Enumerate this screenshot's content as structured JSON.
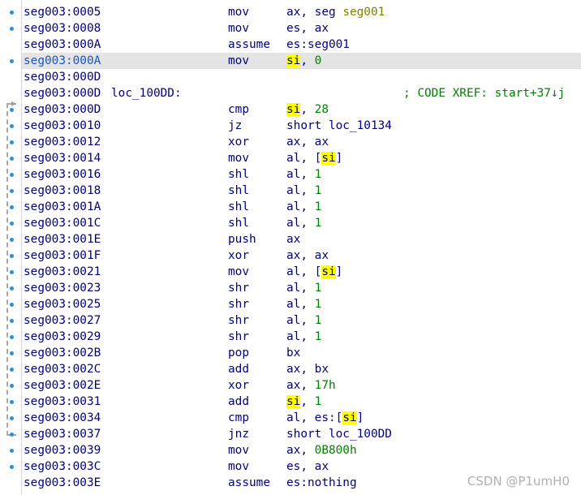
{
  "listing": {
    "rows": [
      {
        "addr": "seg003:0005",
        "label": "",
        "mnem": "mov",
        "ops": [
          {
            "t": "ax, seg ",
            "k": "reg"
          },
          {
            "t": "seg001",
            "k": "seg"
          }
        ],
        "comment": "",
        "highlight": false
      },
      {
        "addr": "seg003:0008",
        "label": "",
        "mnem": "mov",
        "ops": [
          {
            "t": "es, ax",
            "k": "reg"
          }
        ],
        "comment": "",
        "highlight": false
      },
      {
        "addr": "seg003:000A",
        "label": "",
        "mnem": "assume",
        "ops": [
          {
            "t": "es:seg001",
            "k": "reg"
          }
        ],
        "comment": "",
        "highlight": false
      },
      {
        "addr": "seg003:000A",
        "label": "",
        "mnem": "mov",
        "ops": [
          {
            "t": "si",
            "k": "hl"
          },
          {
            "t": ", ",
            "k": "reg"
          },
          {
            "t": "0",
            "k": "num"
          }
        ],
        "comment": "",
        "highlight": true
      },
      {
        "addr": "seg003:000D",
        "label": "",
        "mnem": "",
        "ops": [],
        "comment": "",
        "highlight": false
      },
      {
        "addr": "seg003:000D",
        "label": "loc_100DD:",
        "mnem": "",
        "ops": [],
        "comment": "; CODE XREF: start+37↓j",
        "highlight": false
      },
      {
        "addr": "seg003:000D",
        "label": "",
        "mnem": "cmp",
        "ops": [
          {
            "t": "si",
            "k": "hl"
          },
          {
            "t": ", ",
            "k": "reg"
          },
          {
            "t": "28",
            "k": "num"
          }
        ],
        "comment": "",
        "highlight": false
      },
      {
        "addr": "seg003:0010",
        "label": "",
        "mnem": "jz",
        "ops": [
          {
            "t": "short loc_10134",
            "k": "reg"
          }
        ],
        "comment": "",
        "highlight": false
      },
      {
        "addr": "seg003:0012",
        "label": "",
        "mnem": "xor",
        "ops": [
          {
            "t": "ax, ax",
            "k": "reg"
          }
        ],
        "comment": "",
        "highlight": false
      },
      {
        "addr": "seg003:0014",
        "label": "",
        "mnem": "mov",
        "ops": [
          {
            "t": "al, [",
            "k": "reg"
          },
          {
            "t": "si",
            "k": "hl"
          },
          {
            "t": "]",
            "k": "reg"
          }
        ],
        "comment": "",
        "highlight": false
      },
      {
        "addr": "seg003:0016",
        "label": "",
        "mnem": "shl",
        "ops": [
          {
            "t": "al, ",
            "k": "reg"
          },
          {
            "t": "1",
            "k": "num"
          }
        ],
        "comment": "",
        "highlight": false
      },
      {
        "addr": "seg003:0018",
        "label": "",
        "mnem": "shl",
        "ops": [
          {
            "t": "al, ",
            "k": "reg"
          },
          {
            "t": "1",
            "k": "num"
          }
        ],
        "comment": "",
        "highlight": false
      },
      {
        "addr": "seg003:001A",
        "label": "",
        "mnem": "shl",
        "ops": [
          {
            "t": "al, ",
            "k": "reg"
          },
          {
            "t": "1",
            "k": "num"
          }
        ],
        "comment": "",
        "highlight": false
      },
      {
        "addr": "seg003:001C",
        "label": "",
        "mnem": "shl",
        "ops": [
          {
            "t": "al, ",
            "k": "reg"
          },
          {
            "t": "1",
            "k": "num"
          }
        ],
        "comment": "",
        "highlight": false
      },
      {
        "addr": "seg003:001E",
        "label": "",
        "mnem": "push",
        "ops": [
          {
            "t": "ax",
            "k": "reg"
          }
        ],
        "comment": "",
        "highlight": false
      },
      {
        "addr": "seg003:001F",
        "label": "",
        "mnem": "xor",
        "ops": [
          {
            "t": "ax, ax",
            "k": "reg"
          }
        ],
        "comment": "",
        "highlight": false
      },
      {
        "addr": "seg003:0021",
        "label": "",
        "mnem": "mov",
        "ops": [
          {
            "t": "al, [",
            "k": "reg"
          },
          {
            "t": "si",
            "k": "hl"
          },
          {
            "t": "]",
            "k": "reg"
          }
        ],
        "comment": "",
        "highlight": false
      },
      {
        "addr": "seg003:0023",
        "label": "",
        "mnem": "shr",
        "ops": [
          {
            "t": "al, ",
            "k": "reg"
          },
          {
            "t": "1",
            "k": "num"
          }
        ],
        "comment": "",
        "highlight": false
      },
      {
        "addr": "seg003:0025",
        "label": "",
        "mnem": "shr",
        "ops": [
          {
            "t": "al, ",
            "k": "reg"
          },
          {
            "t": "1",
            "k": "num"
          }
        ],
        "comment": "",
        "highlight": false
      },
      {
        "addr": "seg003:0027",
        "label": "",
        "mnem": "shr",
        "ops": [
          {
            "t": "al, ",
            "k": "reg"
          },
          {
            "t": "1",
            "k": "num"
          }
        ],
        "comment": "",
        "highlight": false
      },
      {
        "addr": "seg003:0029",
        "label": "",
        "mnem": "shr",
        "ops": [
          {
            "t": "al, ",
            "k": "reg"
          },
          {
            "t": "1",
            "k": "num"
          }
        ],
        "comment": "",
        "highlight": false
      },
      {
        "addr": "seg003:002B",
        "label": "",
        "mnem": "pop",
        "ops": [
          {
            "t": "bx",
            "k": "reg"
          }
        ],
        "comment": "",
        "highlight": false
      },
      {
        "addr": "seg003:002C",
        "label": "",
        "mnem": "add",
        "ops": [
          {
            "t": "ax, bx",
            "k": "reg"
          }
        ],
        "comment": "",
        "highlight": false
      },
      {
        "addr": "seg003:002E",
        "label": "",
        "mnem": "xor",
        "ops": [
          {
            "t": "ax, ",
            "k": "reg"
          },
          {
            "t": "17h",
            "k": "num"
          }
        ],
        "comment": "",
        "highlight": false
      },
      {
        "addr": "seg003:0031",
        "label": "",
        "mnem": "add",
        "ops": [
          {
            "t": "si",
            "k": "hl"
          },
          {
            "t": ", ",
            "k": "reg"
          },
          {
            "t": "1",
            "k": "num"
          }
        ],
        "comment": "",
        "highlight": false
      },
      {
        "addr": "seg003:0034",
        "label": "",
        "mnem": "cmp",
        "ops": [
          {
            "t": "al, es:[",
            "k": "reg"
          },
          {
            "t": "si",
            "k": "hl"
          },
          {
            "t": "]",
            "k": "reg"
          }
        ],
        "comment": "",
        "highlight": false
      },
      {
        "addr": "seg003:0037",
        "label": "",
        "mnem": "jnz",
        "ops": [
          {
            "t": "short loc_100DD",
            "k": "reg"
          }
        ],
        "comment": "",
        "highlight": false
      },
      {
        "addr": "seg003:0039",
        "label": "",
        "mnem": "mov",
        "ops": [
          {
            "t": "ax, ",
            "k": "reg"
          },
          {
            "t": "0B800h",
            "k": "num"
          }
        ],
        "comment": "",
        "highlight": false
      },
      {
        "addr": "seg003:003C",
        "label": "",
        "mnem": "mov",
        "ops": [
          {
            "t": "es, ax",
            "k": "reg"
          }
        ],
        "comment": "",
        "highlight": false
      },
      {
        "addr": "seg003:003E",
        "label": "",
        "mnem": "assume",
        "ops": [
          {
            "t": "es:nothing",
            "k": "reg"
          }
        ],
        "comment": "",
        "highlight": false
      }
    ],
    "dot_rows": [
      0,
      1,
      3,
      6,
      7,
      8,
      9,
      10,
      11,
      12,
      13,
      14,
      15,
      16,
      17,
      18,
      19,
      20,
      21,
      22,
      23,
      24,
      25,
      26,
      27,
      28
    ]
  },
  "watermark": "CSDN @P1umH0",
  "colors": {
    "address": "#000080",
    "number": "#008000",
    "segment": "#808000",
    "selection": "#ffff00",
    "gutter_dot": "#2f8fd6"
  }
}
